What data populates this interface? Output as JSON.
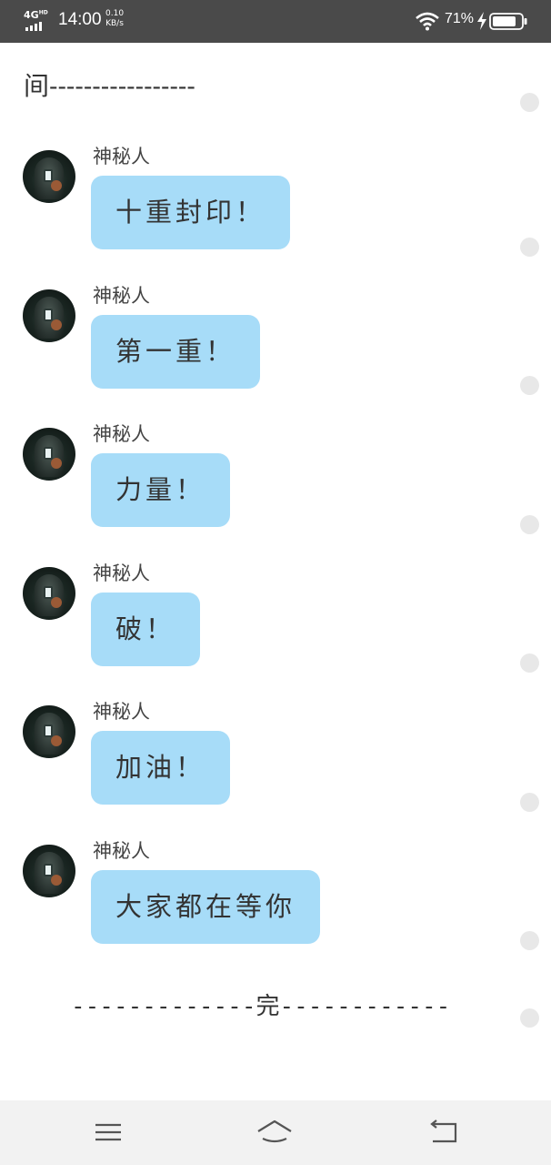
{
  "status_bar": {
    "network": "4G",
    "network_sup": "HD",
    "time": "14:00",
    "speed_value": "0.10",
    "speed_unit": "KB/s",
    "battery_percent": "71%",
    "icons": [
      "signal-icon",
      "wifi-icon",
      "charging-icon",
      "battery-icon"
    ]
  },
  "chat": {
    "top_partial_text": "间-----------------",
    "messages": [
      {
        "sender": "神秘人",
        "text": "十重封印！"
      },
      {
        "sender": "神秘人",
        "text": "第一重！"
      },
      {
        "sender": "神秘人",
        "text": "力量！"
      },
      {
        "sender": "神秘人",
        "text": "破！"
      },
      {
        "sender": "神秘人",
        "text": "加油！"
      },
      {
        "sender": "神秘人",
        "text": "大家都在等你"
      }
    ],
    "end_text": "-------------完------------"
  },
  "nav_bar": {
    "icons": [
      "menu-icon",
      "home-icon",
      "back-icon"
    ]
  },
  "colors": {
    "status_bar_bg": "#4a4a4a",
    "bubble_bg": "#a7dcf8",
    "nav_bar_bg": "#f2f2f2"
  }
}
